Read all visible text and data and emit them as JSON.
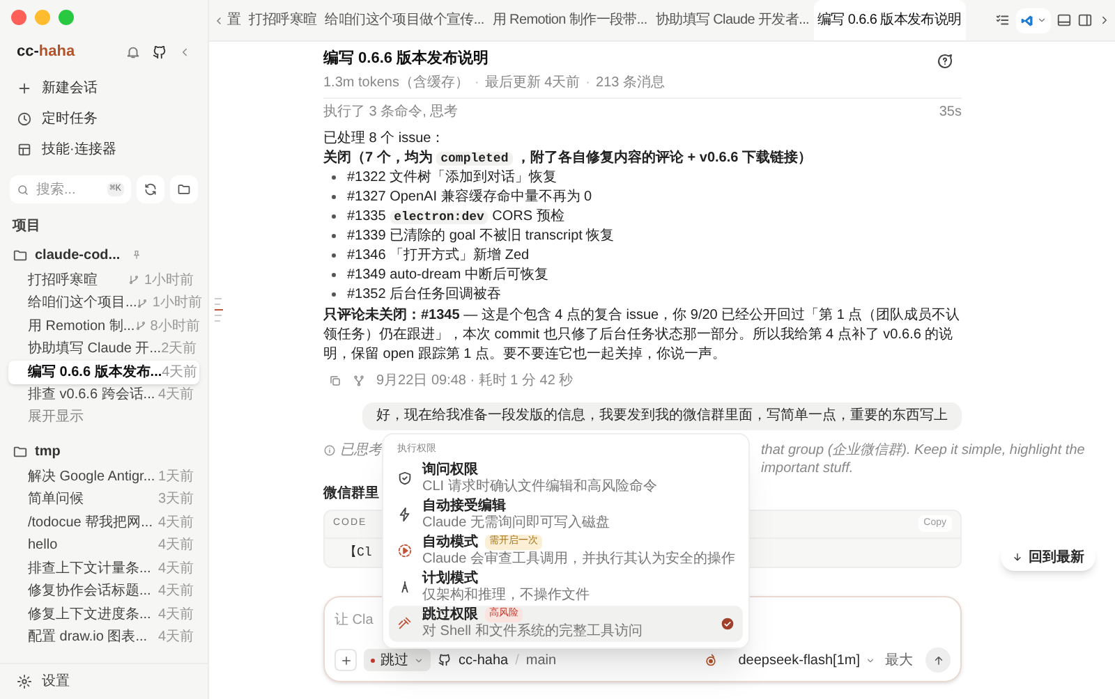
{
  "brand": {
    "prefix": "cc-",
    "accent": "haha"
  },
  "nav": [
    {
      "kind": "new",
      "label": "新建会话"
    },
    {
      "kind": "clock",
      "label": "定时任务"
    },
    {
      "kind": "grid",
      "label": "技能·连接器"
    }
  ],
  "search": {
    "placeholder": "搜索...",
    "shortcut": "⌘K"
  },
  "projects_heading": "项目",
  "projects": [
    {
      "name": "claude-cod...",
      "sessions": [
        {
          "title": "打招呼寒暄",
          "time": "1小时前",
          "branch": true,
          "selected": false
        },
        {
          "title": "给咱们这个项目...",
          "time": "1小时前",
          "branch": true,
          "selected": false
        },
        {
          "title": "用 Remotion 制...",
          "time": "8小时前",
          "branch": true,
          "selected": false
        },
        {
          "title": "协助填写 Claude 开...",
          "time": "2天前",
          "branch": false,
          "selected": false
        },
        {
          "title": "编写 0.6.6 版本发布...",
          "time": "4天前",
          "branch": false,
          "selected": true
        },
        {
          "title": "排查 v0.6.6 跨会话...",
          "time": "4天前",
          "branch": false,
          "selected": false
        }
      ],
      "more": "展开显示"
    },
    {
      "name": "tmp",
      "sessions": [
        {
          "title": "解决 Google Antigr...",
          "time": "1天前",
          "branch": false,
          "selected": false
        },
        {
          "title": "简单问候",
          "time": "3天前",
          "branch": false,
          "selected": false
        },
        {
          "title": "/todocue 帮我把网...",
          "time": "4天前",
          "branch": false,
          "selected": false
        },
        {
          "title": "hello",
          "time": "4天前",
          "branch": false,
          "selected": false
        },
        {
          "title": "排查上下文计量条...",
          "time": "4天前",
          "branch": false,
          "selected": false
        },
        {
          "title": "修复协作会话标题...",
          "time": "4天前",
          "branch": false,
          "selected": false
        },
        {
          "title": "修复上下文进度条...",
          "time": "4天前",
          "branch": false,
          "selected": false
        },
        {
          "title": "配置 draw.io 图表...",
          "time": "4天前",
          "branch": false,
          "selected": false
        }
      ]
    }
  ],
  "settings": "设置",
  "tabs": [
    {
      "label": "置",
      "selected": false
    },
    {
      "label": "打招呼寒暄",
      "selected": false
    },
    {
      "label": "给咱们这个项目做个宣传...",
      "selected": false
    },
    {
      "label": "用 Remotion 制作一段带...",
      "selected": false
    },
    {
      "label": "协助填写 Claude 开发者...",
      "selected": false
    },
    {
      "label": "编写 0.6.6 版本发布说明",
      "selected": true
    }
  ],
  "header": {
    "title": "编写 0.6.6 版本发布说明",
    "meta": [
      "1.3m tokens（含缓存）",
      "最后更新 4天前",
      "213 条消息"
    ],
    "separator": "·"
  },
  "activity": {
    "label": "执行了 3 条命令, 思考",
    "duration": "35s"
  },
  "intro": "已处理 8 个 issue：",
  "closed_heading": [
    {
      "kind": "text",
      "text": "关闭（7 个，均为 "
    },
    {
      "kind": "code",
      "text": "completed"
    },
    {
      "kind": "text",
      "text": " ，附了各自修复内容的评论 + v0.6.6 下载链接）"
    }
  ],
  "issues": [
    [
      {
        "kind": "text",
        "text": "#1322 文件树「添加到对话」恢复"
      }
    ],
    [
      {
        "kind": "text",
        "text": "#1327 OpenAI 兼容缓存命中量不再为 0"
      }
    ],
    [
      {
        "kind": "text",
        "text": "#1335 "
      },
      {
        "kind": "code",
        "text": "electron:dev"
      },
      {
        "kind": "text",
        "text": " CORS 预检"
      }
    ],
    [
      {
        "kind": "text",
        "text": "#1339 已清除的 goal 不被旧 transcript 恢复"
      }
    ],
    [
      {
        "kind": "text",
        "text": "#1346 「打开方式」新增 Zed"
      }
    ],
    [
      {
        "kind": "text",
        "text": "#1349 auto-dream 中断后可恢复"
      }
    ],
    [
      {
        "kind": "text",
        "text": "#1352 后台任务回调被吞"
      }
    ]
  ],
  "note": "**只评论未关闭：#1345** — 这是个包含 4 点的复合 issue，你 9/20 已经公开回过「第 1 点（团队成员不认领任务）仍在跟进」，本次 commit 也只修了后台任务状态那一部分。所以我给第 4 点补了 v0.6.6 的说明，保留 open 跟踪第 1 点。要不要连它也一起关掉，你说一声。",
  "message_meta": "9月22日 09:48 · 耗时 1 分 42 秒",
  "user_message": "好，现在给我准备一段发版的信息，我要发到我的微信群里面，写简单一点，重要的东西写上",
  "thinking": {
    "label": "已思考",
    "tail": "that group (企业微信群). Keep it simple, highlight the important stuff."
  },
  "section_start": "微信群里",
  "code_block": {
    "label": "CODE",
    "copy": "Copy",
    "text": "【Cl"
  },
  "jump_latest": "回到最新",
  "permission_menu": {
    "title": "执行权限",
    "items": [
      {
        "kind": "shield",
        "title": "询问权限",
        "desc": "CLI 请求时确认文件编辑和高风险命令",
        "selected": false
      },
      {
        "kind": "bolt",
        "title": "自动接受编辑",
        "desc": "Claude 无需询问即可写入磁盘",
        "selected": false
      },
      {
        "kind": "auto",
        "title": "自动模式",
        "badge": {
          "text": "需开启一次",
          "kind": "warn"
        },
        "desc": "Claude 会审查工具调用，并执行其认为安全的操作",
        "selected": false
      },
      {
        "kind": "plan",
        "title": "计划模式",
        "desc": "仅架构和推理，不操作文件",
        "selected": false
      },
      {
        "kind": "skip",
        "title": "跳过权限",
        "badge": {
          "text": "高风险",
          "kind": "danger"
        },
        "desc": "对 Shell 和文件系统的完整工具访问",
        "selected": true
      }
    ]
  },
  "composer": {
    "placeholder": "让 Cla",
    "mode": "跳过",
    "repo": "cc-haha",
    "separator": "/",
    "branch": "main",
    "model": "deepseek-flash[1m]",
    "effort": "最大"
  }
}
